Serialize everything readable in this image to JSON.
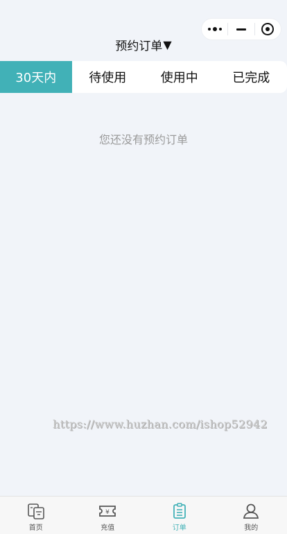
{
  "header": {
    "title": "预约订单",
    "dropdown_arrow": "▼"
  },
  "capsule": {
    "more_icon": "more-dots-icon",
    "minimize_icon": "minus-icon",
    "close_icon": "target-circle-icon"
  },
  "tabs": [
    {
      "label": "30天内",
      "active": true
    },
    {
      "label": "待使用",
      "active": false
    },
    {
      "label": "使用中",
      "active": false
    },
    {
      "label": "已完成",
      "active": false
    }
  ],
  "empty_message": "您还没有预约订单",
  "watermark": "https://www.huzhan.com/ishop52942",
  "bottom_nav": [
    {
      "label": "首页",
      "icon": "home-menu-icon",
      "active": false
    },
    {
      "label": "充值",
      "icon": "ticket-yen-icon",
      "active": false
    },
    {
      "label": "订单",
      "icon": "clipboard-list-icon",
      "active": true
    },
    {
      "label": "我的",
      "icon": "user-profile-icon",
      "active": false
    }
  ],
  "colors": {
    "accent": "#41b1b7",
    "background": "#f1f4f9",
    "empty_text": "#9a9a9a"
  }
}
